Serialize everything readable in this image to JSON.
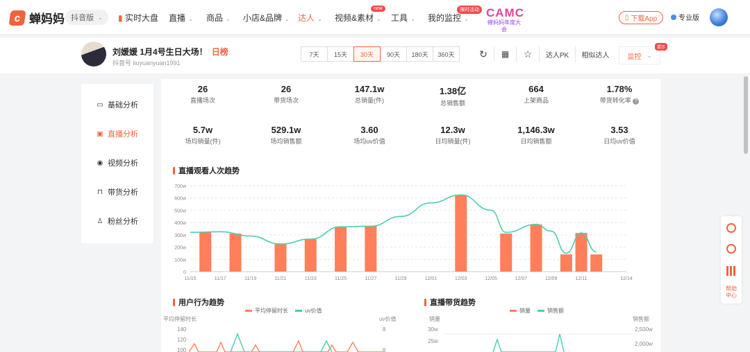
{
  "header": {
    "logo_text": "蝉妈妈",
    "edition": "抖音版",
    "nav": [
      {
        "label": "实时大盘"
      },
      {
        "label": "直播"
      },
      {
        "label": "商品"
      },
      {
        "label": "小店&品牌"
      },
      {
        "label": "达人"
      },
      {
        "label": "视频&素材",
        "badge": "new"
      },
      {
        "label": "工具"
      },
      {
        "label": "我的监控",
        "badge": "限时活动"
      }
    ],
    "camp_logo": "CAMC",
    "camp_sub": "蝉妈妈年度大会",
    "download": "下载App",
    "pro": "专业版"
  },
  "profile": {
    "name": "刘媛媛 1月4号生日大场！",
    "tag": "日榜",
    "douyin_id": "抖音号 liuyuanyuan1991",
    "days": [
      "7天",
      "15天",
      "30天",
      "90天",
      "180天",
      "360天"
    ],
    "active_day": "30天",
    "compare": "达人PK",
    "similar": "相似达人",
    "monitor": "监控",
    "monitor_badge": "提示"
  },
  "sidebar": [
    {
      "label": "基础分析",
      "icon": "chart-icon"
    },
    {
      "label": "直播分析",
      "icon": "live-icon"
    },
    {
      "label": "视频分析",
      "icon": "play-icon"
    },
    {
      "label": "带货分析",
      "icon": "bag-icon"
    },
    {
      "label": "粉丝分析",
      "icon": "user-icon"
    }
  ],
  "stats_row1": [
    {
      "value": "26",
      "label": "直播场次"
    },
    {
      "value": "26",
      "label": "带货场次"
    },
    {
      "value": "147.1w",
      "label": "总销量(件)"
    },
    {
      "value": "1.38亿",
      "label": "总销售额"
    },
    {
      "value": "664",
      "label": "上架商品"
    },
    {
      "value": "1.78%",
      "label": "带货转化率"
    }
  ],
  "stats_row2": [
    {
      "value": "5.7w",
      "label": "场均销量(件)"
    },
    {
      "value": "529.1w",
      "label": "场均销售额"
    },
    {
      "value": "3.60",
      "label": "场均uv价值"
    },
    {
      "value": "12.3w",
      "label": "日均销量(件)"
    },
    {
      "value": "1,146.3w",
      "label": "日均销售额"
    },
    {
      "value": "3.53",
      "label": "日均uv价值"
    }
  ],
  "watch_trend_title": "直播观看人次趋势",
  "behavior_title": "用户行为趋势",
  "behavior_legend": [
    "平均停留时长",
    "uv价值"
  ],
  "behavior_left_axis": "平均停留时长",
  "behavior_right_axis": "uv价值",
  "behavior_ticks_left": [
    "140",
    "120",
    "100"
  ],
  "behavior_ticks_right": [
    "8",
    "6"
  ],
  "sales_title": "直播带货趋势",
  "sales_legend": [
    "销量",
    "销售额"
  ],
  "sales_left_axis": "销量",
  "sales_right_axis": "销售额",
  "sales_ticks_left": [
    "30w",
    "25w"
  ],
  "sales_ticks_right": [
    "2,500w",
    "2,000w"
  ],
  "rail_help": "帮助中心",
  "colors": {
    "accent": "#f0643c",
    "bar": "#ff7f5a",
    "line": "#4ecbb0"
  },
  "chart_data": {
    "type": "bar",
    "title": "直播观看人次趋势",
    "x_ticks": [
      "11/15",
      "11/17",
      "11/19",
      "11/21",
      "11/23",
      "11/25",
      "11/27",
      "11/29",
      "12/01",
      "12/03",
      "12/05",
      "12/07",
      "12/09",
      "12/11",
      "12/14"
    ],
    "y_ticks": [
      "0",
      "100w",
      "200w",
      "300w",
      "400w",
      "500w",
      "600w",
      "700w"
    ],
    "ylim": [
      0,
      700
    ],
    "bars": [
      {
        "x": "11/16",
        "value": 320
      },
      {
        "x": "11/18",
        "value": 310
      },
      {
        "x": "11/21",
        "value": 225
      },
      {
        "x": "11/23",
        "value": 265
      },
      {
        "x": "11/25",
        "value": 365
      },
      {
        "x": "11/27",
        "value": 370
      },
      {
        "x": "12/03",
        "value": 625
      },
      {
        "x": "12/06",
        "value": 310
      },
      {
        "x": "12/08",
        "value": 385
      },
      {
        "x": "12/10",
        "value": 140
      },
      {
        "x": "12/11",
        "value": 315
      },
      {
        "x": "12/12",
        "value": 140
      }
    ],
    "trend_line": [
      {
        "x": "11/15",
        "value": 320
      },
      {
        "x": "11/17",
        "value": 325
      },
      {
        "x": "11/19",
        "value": 290
      },
      {
        "x": "11/21",
        "value": 225
      },
      {
        "x": "11/23",
        "value": 265
      },
      {
        "x": "11/25",
        "value": 365
      },
      {
        "x": "11/27",
        "value": 370
      },
      {
        "x": "11/29",
        "value": 450
      },
      {
        "x": "12/01",
        "value": 560
      },
      {
        "x": "12/03",
        "value": 625
      },
      {
        "x": "12/05",
        "value": 500
      },
      {
        "x": "12/06",
        "value": 320
      },
      {
        "x": "12/08",
        "value": 385
      },
      {
        "x": "12/09",
        "value": 330
      },
      {
        "x": "12/10",
        "value": 150
      },
      {
        "x": "12/11",
        "value": 315
      },
      {
        "x": "12/12",
        "value": 160
      }
    ]
  }
}
